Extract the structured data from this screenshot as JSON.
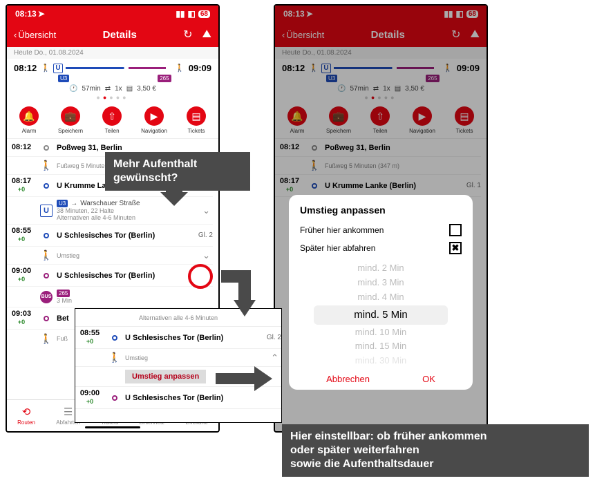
{
  "statusbar": {
    "time": "08:13",
    "battery": "68"
  },
  "header": {
    "back": "Übersicht",
    "title": "Details"
  },
  "date": "Heute Do., 01.08.2024",
  "summary": {
    "dep": "08:12",
    "arr": "09:09",
    "u_line": "U3",
    "bus_line": "265",
    "duration": "57min",
    "transfers": "1x",
    "price": "3,50 €"
  },
  "actions": [
    "Alarm",
    "Speichern",
    "Teilen",
    "Navigation",
    "Tickets"
  ],
  "stops": {
    "s1_time": "08:12",
    "s1_name": "Poßweg 31, Berlin",
    "s2_walk": "Fußweg 5 Minuten (347 m)",
    "s3_time": "08:17",
    "s3_name": "U Krumme Lanke (Berlin)",
    "s3_plat": "Gl. 1",
    "s4_line": "U3",
    "s4_dest": "Warschauer Straße",
    "s4_sub": "38 Minuten, 22 Halte",
    "s4_alt": "Alternativen alle 4-6 Minuten",
    "s5_time": "08:55",
    "s5_name": "U Schlesisches Tor (Berlin)",
    "s5_plat": "Gl. 2",
    "s6_transfer": "Umstieg",
    "s7_time": "09:00",
    "s7_name": "U Schlesisches Tor (Berlin)",
    "s8_line": "265",
    "s8_sub": "3 Min",
    "s9_time": "09:03",
    "s9_name": "Bet",
    "s10_walk": "Fuß",
    "delay": "+0"
  },
  "tabs": [
    "Routen",
    "Abfahrten",
    "Tickets",
    "Liniennetz",
    "Livekarte"
  ],
  "annotation1_l1": "Mehr Aufenthalt",
  "annotation1_l2": "gewünscht?",
  "annotation2_l1": "Hier einstellbar: ob früher ankommen",
  "annotation2_l2": "oder später weiterfahren",
  "annotation2_l3": "sowie die Aufenthaltsdauer",
  "excerpt": {
    "alt": "Alternativen alle 4-6 Minuten",
    "t1": "08:55",
    "n1": "U Schlesisches Tor (Berlin)",
    "p1": "Gl. 2",
    "transfer": "Umstieg",
    "adjust": "Umstieg anpassen",
    "t2": "09:00",
    "n2": "U Schlesisches Tor (Berlin)"
  },
  "modal": {
    "title": "Umstieg anpassen",
    "opt1": "Früher hier ankommen",
    "opt2": "Später hier abfahren",
    "picker": [
      "mind. 2 Min",
      "mind. 3 Min",
      "mind. 4 Min",
      "mind. 5 Min",
      "mind. 10 Min",
      "mind. 15 Min",
      "mind. 30 Min"
    ],
    "cancel": "Abbrechen",
    "ok": "OK"
  }
}
